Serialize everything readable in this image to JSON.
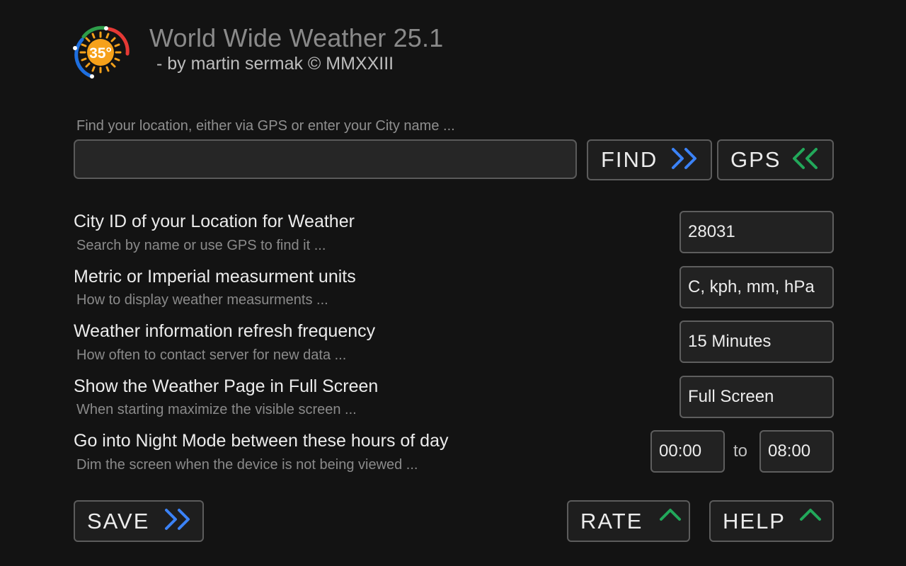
{
  "header": {
    "title": "World Wide Weather 25.1",
    "subtitle": "- by martin sermak © MMXXIII",
    "logo_temperature": "35°"
  },
  "search": {
    "hint": "Find your location, either via GPS or enter your City name ...",
    "value": "",
    "find_label": "FIND",
    "gps_label": "GPS"
  },
  "settings": {
    "city_id": {
      "label": "City ID of your Location for Weather",
      "hint": "Search by name or use GPS to find it ...",
      "value": "28031"
    },
    "units": {
      "label": "Metric or Imperial measurment units",
      "hint": "How to display weather measurments ...",
      "value": "C, kph, mm, hPa"
    },
    "refresh": {
      "label": "Weather information refresh frequency",
      "hint": "How often to contact server for new data ...",
      "value": "15 Minutes"
    },
    "fullscreen": {
      "label": "Show the Weather Page in Full Screen",
      "hint": "When starting maximize the visible screen ...",
      "value": "Full Screen"
    },
    "night_mode": {
      "label": "Go into Night Mode between these hours of day",
      "hint": "Dim the screen when the device is not being viewed ...",
      "start": "00:00",
      "to_label": "to",
      "end": "08:00"
    }
  },
  "actions": {
    "save_label": "SAVE",
    "rate_label": "RATE",
    "help_label": "HELP"
  },
  "colors": {
    "background": "#131313",
    "blue_accent": "#3b82f6",
    "green_accent": "#22a85a",
    "logo_orange": "#f6a11a",
    "logo_red": "#e53935",
    "logo_green": "#2e9e4a",
    "logo_blue": "#1e6fe0"
  },
  "icons": {
    "find": "double-chevron-right-icon",
    "gps": "double-chevron-left-icon",
    "save": "double-chevron-right-icon",
    "rate": "chevron-up-icon",
    "help": "chevron-up-icon"
  }
}
